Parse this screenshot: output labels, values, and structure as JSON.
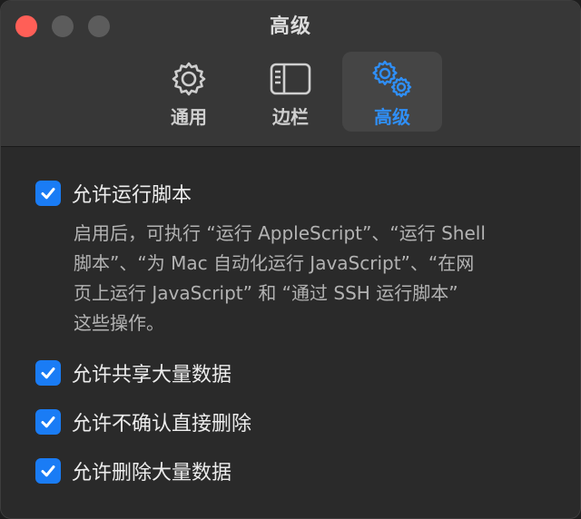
{
  "window": {
    "title": "高级"
  },
  "tabs": [
    {
      "label": "通用",
      "icon": "gear-icon",
      "active": false
    },
    {
      "label": "边栏",
      "icon": "sidebar-icon",
      "active": false
    },
    {
      "label": "高级",
      "icon": "gears-icon",
      "active": true
    }
  ],
  "options": [
    {
      "label": "允许运行脚本",
      "checked": true,
      "description_lines": [
        "启用后，可执行 “运行 AppleScript”、“运行 Shell",
        "脚本”、“为 Mac 自动化运行 JavaScript”、“在网",
        "页上运行 JavaScript” 和 “通过 SSH 运行脚本”",
        "这些操作。"
      ]
    },
    {
      "label": "允许共享大量数据",
      "checked": true
    },
    {
      "label": "允许不确认直接删除",
      "checked": true
    },
    {
      "label": "允许删除大量数据",
      "checked": true
    }
  ],
  "colors": {
    "accent": "#2f8ff8",
    "checkbox": "#1a7cf5",
    "close": "#ff5f57",
    "window_bg": "#2a2a2a",
    "toolbar_bg": "#373737"
  }
}
